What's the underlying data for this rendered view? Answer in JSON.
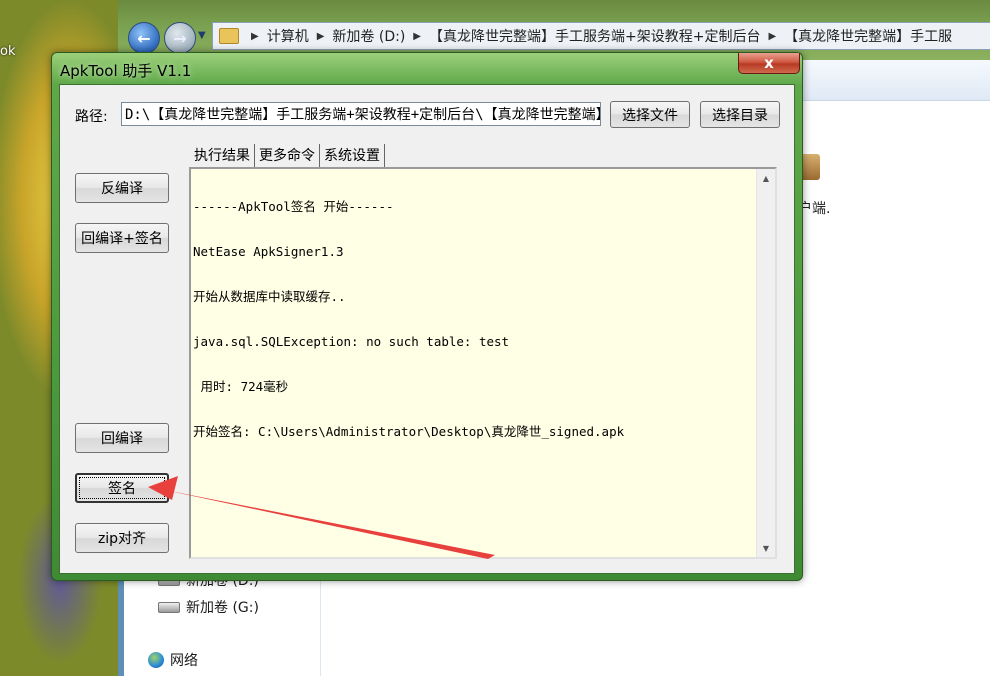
{
  "desktop": {
    "label": "ok"
  },
  "explorer": {
    "back_glyph": "←",
    "forward_glyph": "→",
    "breadcrumbs": [
      "计算机",
      "新加卷 (D:)",
      "【真龙降世完整端】手工服务端+架设教程+定制后台",
      "【真龙降世完整端】手工服"
    ],
    "nav_items": [
      "新加卷 (D:)",
      "新加卷 (G:)",
      "网络"
    ],
    "right_label": "户端."
  },
  "dialog": {
    "title": "ApkTool 助手 V1.1",
    "close_glyph": "x",
    "path_label": "路径:",
    "path_value": "D:\\【真龙降世完整端】手工服务端+架设教程+定制后台\\【真龙降世完整端】手工服务端",
    "select_file_label": "选择文件",
    "select_dir_label": "选择目录",
    "buttons": {
      "decompile": "反编译",
      "recompile_sign": "回编译+签名",
      "recompile": "回编译",
      "sign": "签名",
      "zipalign": "zip对齐"
    },
    "tabs": [
      "执行结果",
      "更多命令",
      "系统设置"
    ],
    "output_lines": [
      "------ApkTool签名 开始------",
      "NetEase ApkSigner1.3",
      "开始从数据库中读取缓存..",
      "java.sql.SQLException: no such table: test",
      " 用时: 724毫秒",
      "开始签名: C:\\Users\\Administrator\\Desktop\\真龙降世_signed.apk"
    ],
    "scroll_up_glyph": "▲",
    "scroll_down_glyph": "▼"
  },
  "colors": {
    "annotation_arrow": "#e8403c",
    "dialog_frame": "#4c9a3e",
    "output_bg": "#ffffe6"
  }
}
